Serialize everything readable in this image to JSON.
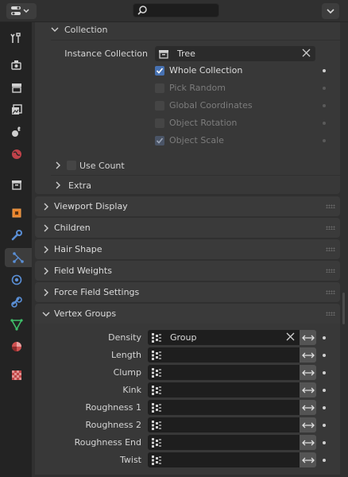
{
  "header": {
    "editor_icon": "properties-editor-icon",
    "search_placeholder": "",
    "filter_icon": "chevron-down-icon"
  },
  "tabs": [
    {
      "name": "tool",
      "icon": "tool-icon"
    },
    {
      "name": "render",
      "icon": "render-icon"
    },
    {
      "name": "output",
      "icon": "output-icon"
    },
    {
      "name": "view-layer",
      "icon": "view-layer-icon"
    },
    {
      "name": "scene",
      "icon": "scene-icon"
    },
    {
      "name": "world",
      "icon": "world-icon"
    },
    {
      "name": "collection",
      "icon": "collection-icon"
    },
    {
      "name": "object",
      "icon": "object-icon"
    },
    {
      "name": "modifiers",
      "icon": "wrench-icon"
    },
    {
      "name": "particles",
      "icon": "particles-icon",
      "active": true
    },
    {
      "name": "physics",
      "icon": "physics-icon"
    },
    {
      "name": "constraints",
      "icon": "constraints-icon"
    },
    {
      "name": "data",
      "icon": "mesh-data-icon"
    },
    {
      "name": "material",
      "icon": "material-icon"
    },
    {
      "name": "texture",
      "icon": "texture-icon"
    }
  ],
  "collection_panel": {
    "title": "Collection",
    "instance_collection_label": "Instance Collection",
    "instance_collection_value": "Tree",
    "checks": [
      {
        "label": "Whole Collection",
        "checked": true,
        "enabled": true
      },
      {
        "label": "Pick Random",
        "checked": false,
        "enabled": false
      },
      {
        "label": "Global Coordinates",
        "checked": false,
        "enabled": false
      },
      {
        "label": "Object Rotation",
        "checked": false,
        "enabled": false
      },
      {
        "label": "Object Scale",
        "checked": true,
        "enabled": false
      }
    ],
    "use_count_label": "Use Count",
    "extra_label": "Extra"
  },
  "panels": {
    "viewport_display": "Viewport Display",
    "children": "Children",
    "hair_shape": "Hair Shape",
    "field_weights": "Field Weights",
    "force_field_settings": "Force Field Settings",
    "vertex_groups": "Vertex Groups"
  },
  "vertex_groups": [
    {
      "label": "Density",
      "value": "Group"
    },
    {
      "label": "Length",
      "value": ""
    },
    {
      "label": "Clump",
      "value": ""
    },
    {
      "label": "Kink",
      "value": ""
    },
    {
      "label": "Roughness 1",
      "value": ""
    },
    {
      "label": "Roughness 2",
      "value": ""
    },
    {
      "label": "Roughness End",
      "value": ""
    },
    {
      "label": "Twist",
      "value": ""
    }
  ],
  "colors": {
    "accent": "#4772b3",
    "panel": "#3a3a3a",
    "background": "#303030",
    "tab_strip": "#232323"
  }
}
